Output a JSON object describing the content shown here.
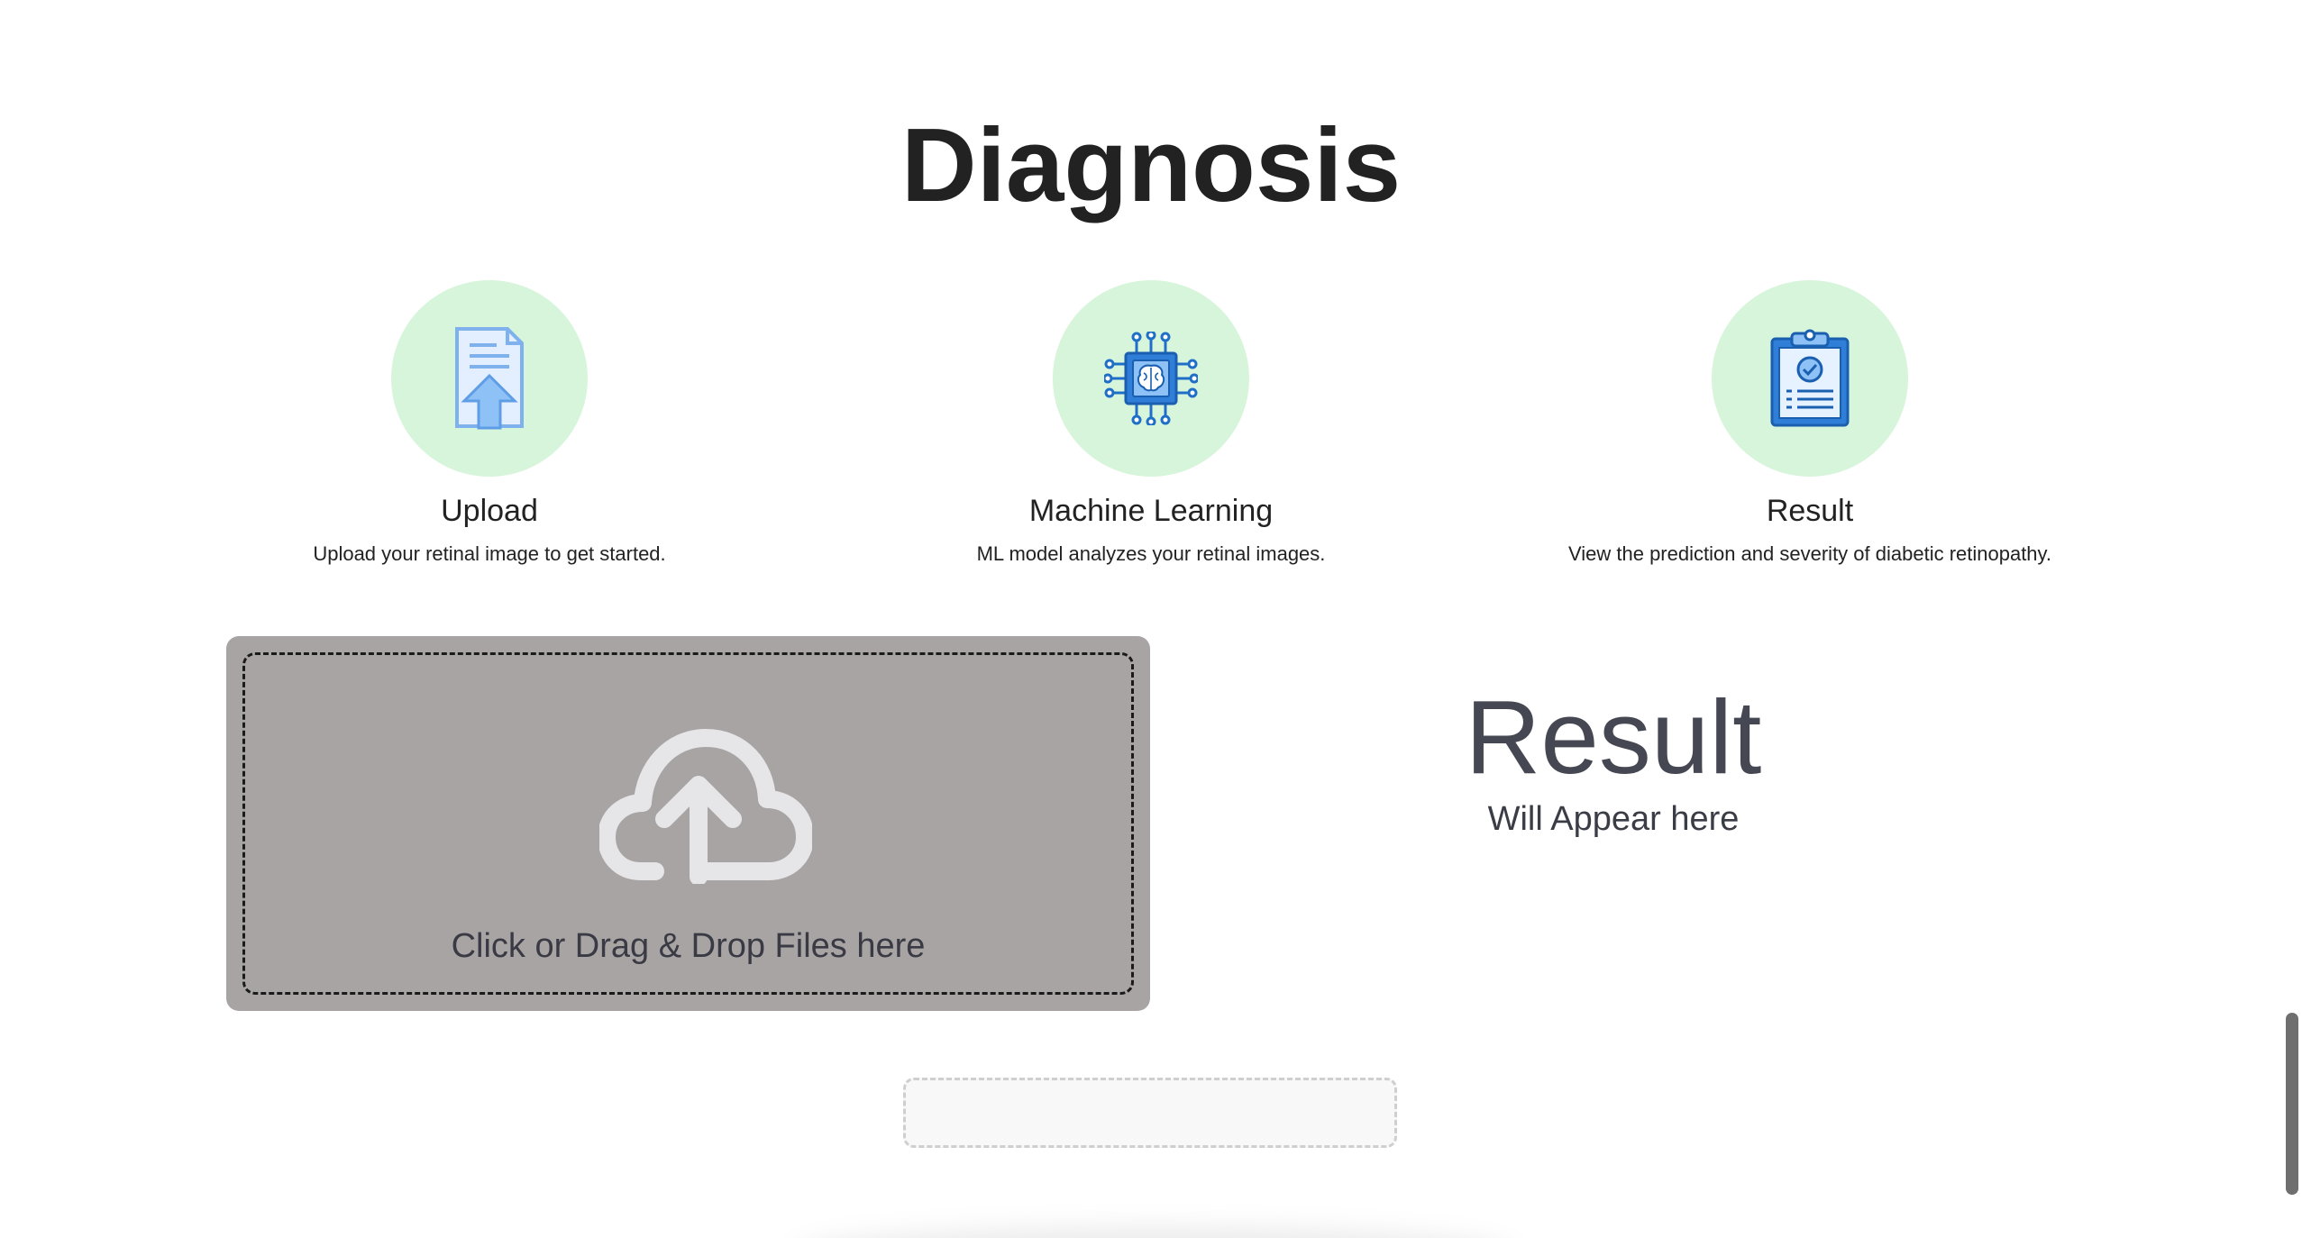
{
  "page": {
    "title": "Diagnosis"
  },
  "steps": [
    {
      "icon": "document-upload-icon",
      "title": "Upload",
      "description": "Upload your retinal image to get started."
    },
    {
      "icon": "brain-chip-icon",
      "title": "Machine Learning",
      "description": "ML model analyzes your retinal images."
    },
    {
      "icon": "clipboard-check-icon",
      "title": "Result",
      "description": "View the prediction and severity of diabetic retinopathy."
    }
  ],
  "upload": {
    "icon": "cloud-upload-icon",
    "label": "Click or Drag & Drop Files here"
  },
  "result": {
    "heading": "Result",
    "subtext": "Will Appear here"
  },
  "colors": {
    "step_circle": "#d7f5da",
    "dropzone_bg": "#a8a4a4",
    "icon_blue": "#2f7fd8",
    "icon_light_blue": "#8ec1f5"
  }
}
